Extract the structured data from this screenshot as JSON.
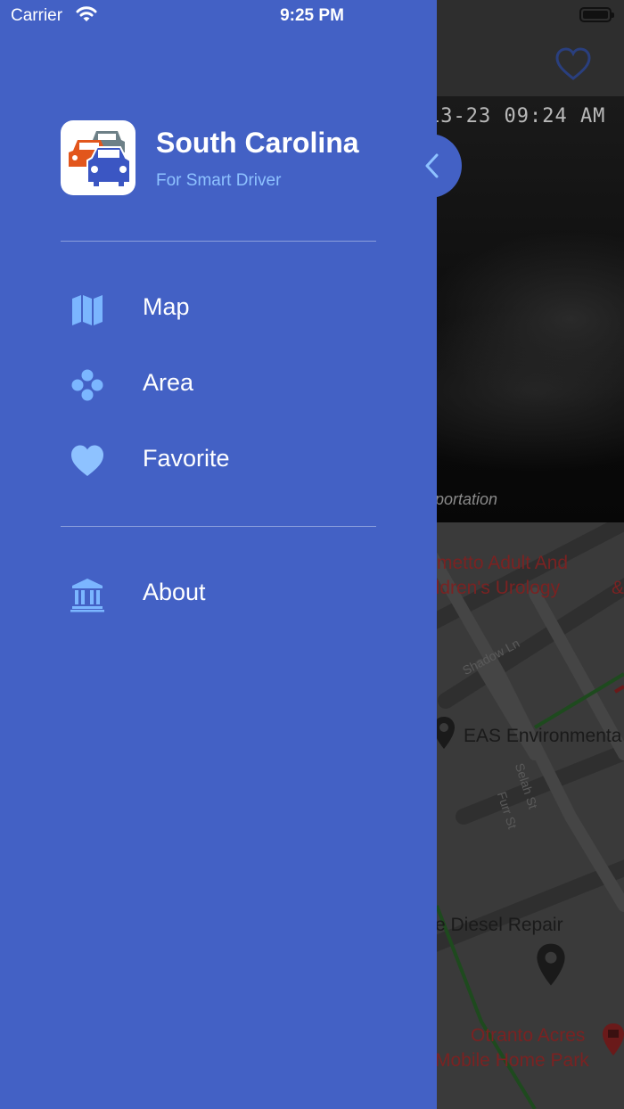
{
  "status_bar": {
    "carrier": "Carrier",
    "time": "9:25 PM"
  },
  "drawer": {
    "app_title": "South Carolina",
    "app_subtitle": "For Smart Driver",
    "menu": [
      {
        "label": "Map",
        "icon": "map-icon"
      },
      {
        "label": "Area",
        "icon": "area-dots-icon"
      },
      {
        "label": "Favorite",
        "icon": "heart-icon"
      }
    ],
    "secondary_menu": [
      {
        "label": "About",
        "icon": "institution-icon"
      }
    ]
  },
  "background": {
    "camera_timestamp": "13-23  09:24 AM",
    "camera_credit": "portation",
    "map_labels": {
      "poi_1_line1": "metto Adult And",
      "poi_1_line2": "ildren's Urology",
      "poi_amp": "&",
      "street_1": "Shadow Ln",
      "poi_2": "EAS Environmenta",
      "street_2": "Selah St",
      "street_3": "Furr St",
      "poi_3": "e Diesel Repair",
      "poi_4_line1": "Otranto Acres",
      "poi_4_line2": "Mobile Home Park"
    }
  },
  "colors": {
    "drawer_bg": "#4361c5",
    "accent_light_blue": "#8ec2ff",
    "subtitle": "#8ec2ff"
  }
}
